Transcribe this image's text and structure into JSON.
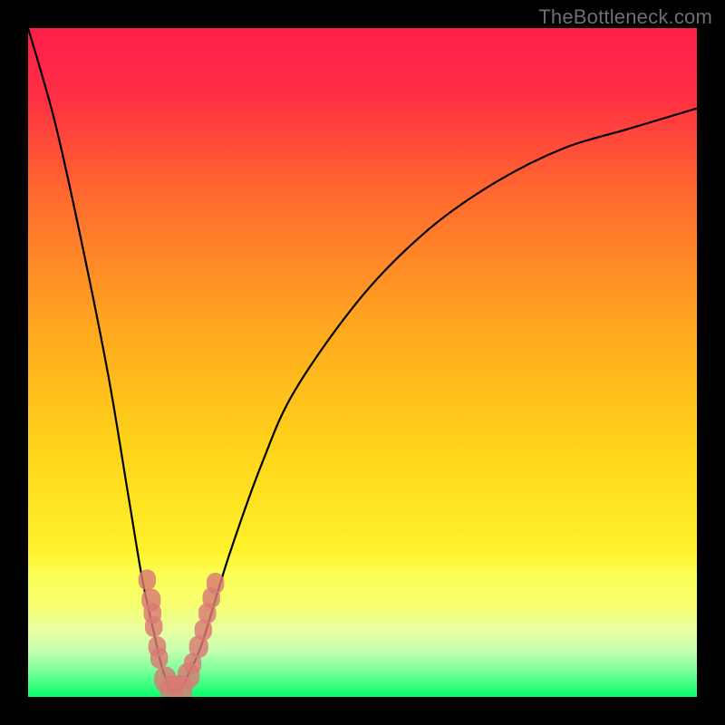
{
  "watermark": "TheBottleneck.com",
  "colors": {
    "frame": "#000000",
    "curve": "#000000",
    "marker": "#d97a74",
    "gradient_top": "#ff1f4b",
    "gradient_mid_upper": "#ff6a2f",
    "gradient_mid": "#ffd21a",
    "gradient_lower_band": "#f8ff6e",
    "gradient_bottom": "#08ff6a"
  },
  "chart_data": {
    "type": "line",
    "title": "",
    "xlabel": "",
    "ylabel": "",
    "xlim": [
      0,
      100
    ],
    "ylim": [
      0,
      100
    ],
    "grid": false,
    "series": [
      {
        "name": "bottleneck-curve",
        "x": [
          0,
          4,
          8,
          12,
          15,
          17,
          18.5,
          19.5,
          20,
          20.5,
          21,
          22,
          23,
          24,
          26,
          30,
          35,
          40,
          50,
          60,
          70,
          80,
          90,
          100
        ],
        "y": [
          100,
          86,
          68,
          48,
          30,
          18,
          11,
          6.5,
          4.5,
          3,
          1.5,
          1,
          1.5,
          3.5,
          8,
          21,
          35,
          46,
          60,
          70,
          77,
          82,
          85,
          88
        ]
      }
    ],
    "markers": [
      {
        "x": 17.8,
        "y": 17.5,
        "r": 1.2
      },
      {
        "x": 18.4,
        "y": 14.5,
        "r": 1.3
      },
      {
        "x": 18.6,
        "y": 12.5,
        "r": 1.2
      },
      {
        "x": 18.8,
        "y": 10.5,
        "r": 1.2
      },
      {
        "x": 19.3,
        "y": 7.5,
        "r": 1.2
      },
      {
        "x": 19.6,
        "y": 5.8,
        "r": 1.2
      },
      {
        "x": 20.5,
        "y": 2.6,
        "r": 1.5
      },
      {
        "x": 21.5,
        "y": 1.2,
        "r": 1.6
      },
      {
        "x": 22.8,
        "y": 1.2,
        "r": 1.6
      },
      {
        "x": 24.0,
        "y": 3.2,
        "r": 1.5
      },
      {
        "x": 24.6,
        "y": 5.0,
        "r": 1.2
      },
      {
        "x": 25.5,
        "y": 7.5,
        "r": 1.3
      },
      {
        "x": 26.2,
        "y": 10.0,
        "r": 1.2
      },
      {
        "x": 26.8,
        "y": 12.5,
        "r": 1.2
      },
      {
        "x": 27.4,
        "y": 14.8,
        "r": 1.2
      },
      {
        "x": 28.0,
        "y": 17.0,
        "r": 1.2
      }
    ]
  }
}
